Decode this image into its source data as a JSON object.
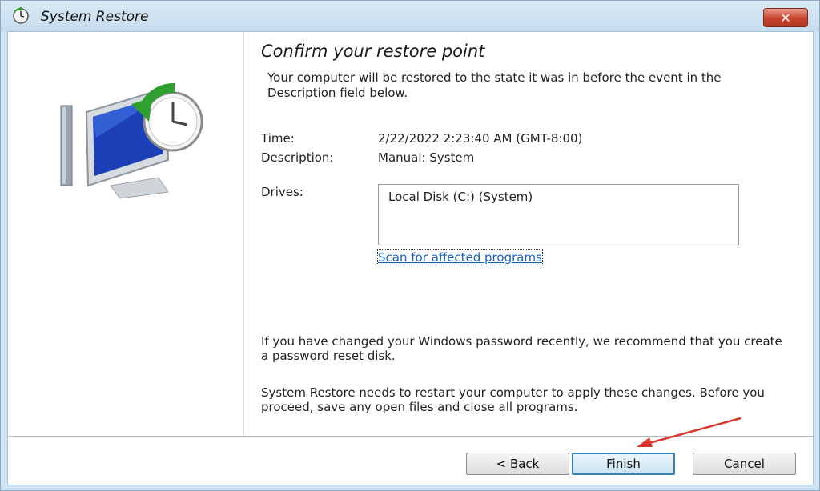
{
  "window": {
    "title": "System Restore",
    "close_label": "✕"
  },
  "main": {
    "heading": "Confirm your restore point",
    "intro": "Your computer will be restored to the state it was in before the event in the Description field below.",
    "time_label": "Time:",
    "time_value": "2/22/2022 2:23:40 AM (GMT-8:00)",
    "description_label": "Description:",
    "description_value": "Manual: System",
    "drives_label": "Drives:",
    "drives": [
      "Local Disk (C:) (System)"
    ],
    "scan_link": "Scan for affected programs",
    "password_note": "If you have changed your Windows password recently, we recommend that you create a password reset disk.",
    "restart_note": "System Restore needs to restart your computer to apply these changes. Before you proceed, save any open files and close all programs."
  },
  "footer": {
    "back_label": "< Back",
    "finish_label": "Finish",
    "cancel_label": "Cancel"
  },
  "colors": {
    "link": "#1c63b8",
    "annotation_arrow": "#d9362c",
    "close_button": "#c8452d"
  },
  "icons": {
    "title": "system-restore-icon",
    "hero": "system-restore-monitor-clock-icon"
  }
}
